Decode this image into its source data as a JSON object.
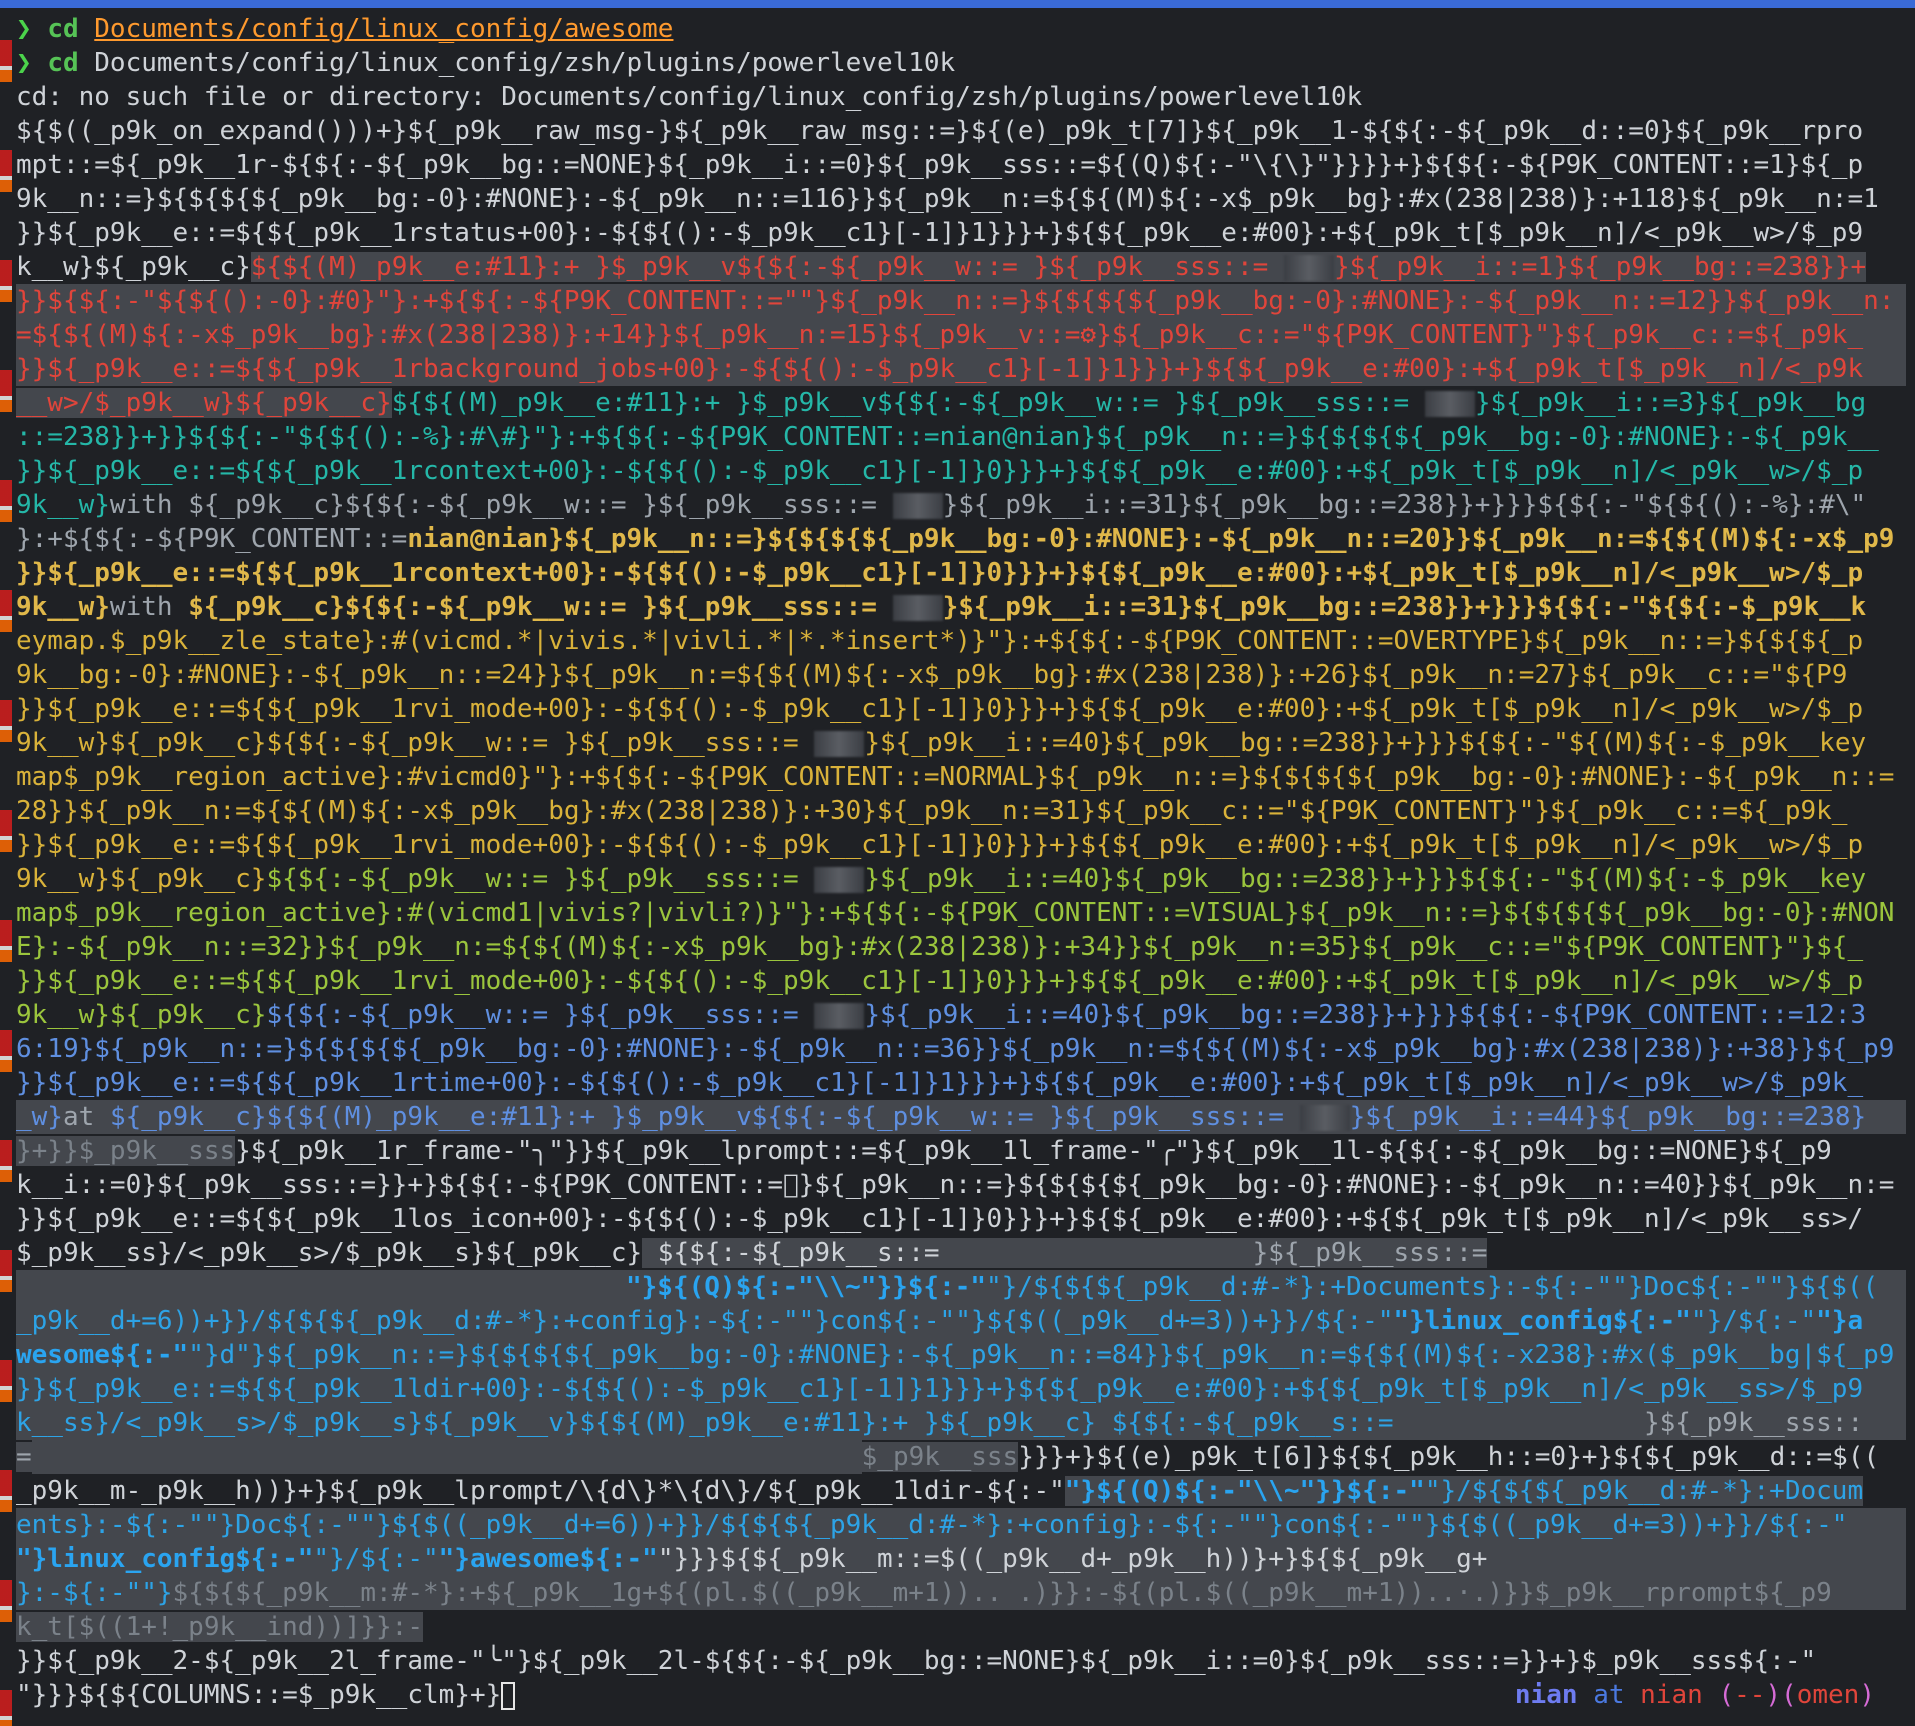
{
  "terminal": {
    "line1": {
      "arrow": "❯",
      "cmd": "cd",
      "path": "Documents/config/linux_config/awesome"
    },
    "line2": {
      "arrow": "❯",
      "cmd": "cd",
      "path": "Documents/config/linux_config/zsh/plugins/powerlevel10k"
    },
    "error": "cd: no such file or directory: Documents/config/linux_config/zsh/plugins/powerlevel10k",
    "garbage": [
      {
        "cls": "c-white",
        "text": "${$((_p9k_on_expand()))+}${_p9k__raw_msg-}${_p9k__raw_msg::=}${(e)_p9k_t[7]}${_p9k__1-${${:-${_p9k__d::=0}${_p9k__rpro"
      },
      {
        "cls": "c-white",
        "text": "mpt::=${_p9k__1r-${${:-${_p9k__bg::=NONE}${_p9k__i::=0}${_p9k__sss::=${(Q)${:-\"\\{\\}\"}}}}+}${${:-${P9K_CONTENT::=1}${_p"
      },
      {
        "cls": "c-white",
        "text": "9k__n::=}${${${${_p9k__bg:-0}:#NONE}:-${_p9k__n::=116}}${_p9k__n:=${${(M)${:-x$_p9k__bg}:#x(238|238)}:+118}${_p9k__n:=1"
      },
      {
        "cls": "c-white",
        "text": "}}${_p9k__e::=${${_p9k__1rstatus+00}:-${${():-$_p9k__c1}[-1]}1}}}+}${${_p9k__e:#00}:+${_p9k_t[$_p9k__n]/<_p9k__w>/$_p9"
      }
    ],
    "seg_line5_a": "k__w}${_p9k__c}",
    "seg_line5_b": "${${(M)_p9k__e:#11}:+ }$_p9k__v${${:-${_p9k__w::= }${_p9k__sss::= ",
    "seg_line5_c": "}${_p9k__i::=1}${_p9k__bg::=238}}+",
    "red_lines": [
      "}}${${:-\"${${():-0}:#0}\"}:+${${:-${P9K_CONTENT::=\"\"}${_p9k__n::=}${${${${_p9k__bg:-0}:#NONE}:-${_p9k__n::=12}}${_p9k__n:",
      "=${${(M)${:-x$_p9k__bg}:#x(238|238)}:+14}}${_p9k__n:=15}${_p9k__v::=⚙}${_p9k__c::=\"${P9K_CONTENT}\"}${_p9k__c::=${_p9k_",
      "}}${_p9k__e::=${${_p9k__1rbackground_jobs+00}:-${${():-$_p9k__c1}[-1]}1}}}+}${${_p9k__e:#00}:+${_p9k_t[$_p9k__n]/<_p9k"
    ],
    "line9_red": "__w>/$_p9k__w}${_p9k__c}",
    "line9_teal_a": "${${(M)_p9k__e:#11}:+ }$_p9k__v${${:-${_p9k__w::= }${_p9k__sss::= ",
    "line9_teal_b": "}${_p9k__i::=3}${_p9k__bg",
    "teal_lines": [
      "::=238}}+}}${${:-\"${${():-%}:#\\#}\"}:+${${:-${P9K_CONTENT::=nian@nian}${_p9k__n::=}${${${${_p9k__bg:-0}:#NONE}:-${_p9k__",
      "}}${_p9k__e::=${${_p9k__1rcontext+00}:-${${():-$_p9k__c1}[-1]}0}}}+}${${_p9k__e:#00}:+${_p9k_t[$_p9k__n]/<_p9k__w>/$_p"
    ],
    "line12_teal": "9k__w}",
    "line12_grey_a": "with ${_p9k__c}${${:-${_p9k__w::= }${_p9k__sss::= ",
    "line12_grey_b": "}${_p9k__i::=31}${_p9k__bg::=238}}+}}}${${:-\"${${():-%}:#\\\"",
    "line13_grey": "}:+${${:-${P9K_CONTENT::=",
    "line13_bold": "nian@nian",
    "line13_grey_b": "}${_p9k__n::=}${${${${_p9k__bg:-0}:#NONE}:-${_p9k__n::=20}}${_p9k__n:=${${(M)${:-x$_p9",
    "yellowb_lines": [
      "}}${_p9k__e::=${${_p9k__1rcontext+00}:-${${():-$_p9k__c1}[-1]}0}}}+}${${_p9k__e:#00}:+${_p9k_t[$_p9k__n]/<_p9k__w>/$_p"
    ],
    "line15_yb": "9k__w}",
    "line15_grey_a": "with ",
    "line15_yb_b": "${_p9k__c}${${:-${_p9k__w::= }${_p9k__sss::= ",
    "line15_yb_c": "}${_p9k__i::=31}${_p9k__bg::=238}}+}}}${${:-\"${${:-$_p9k__k",
    "yellow_lines": [
      "eymap.$_p9k__zle_state}:#(vicmd.*|vivis.*|vivli.*|*.*insert*)}\"}:+${${:-${P9K_CONTENT::=OVERTYPE}${_p9k__n::=}${${${_p",
      "9k__bg:-0}:#NONE}:-${_p9k__n::=24}}${_p9k__n:=${${(M)${:-x$_p9k__bg}:#x(238|238)}:+26}${_p9k__n:=27}${_p9k__c::=\"${P9",
      "}}${_p9k__e::=${${_p9k__1rvi_mode+00}:-${${():-$_p9k__c1}[-1]}0}}}+}${${_p9k__e:#00}:+${_p9k_t[$_p9k__n]/<_p9k__w>/$_p"
    ],
    "line19_yellow_a": "9k__w}${_p9k__c}",
    "line19_yellow_b": "${${:-${_p9k__w::= }${_p9k__sss::= ",
    "line19_yellow_c": "}${_p9k__i::=40}${_p9k__bg::=238}}+}}}${${:-\"${(M)${:-$_p9k__key",
    "yellow2_lines": [
      "map$_p9k__region_active}:#vicmd0}\"}:+${${:-${P9K_CONTENT::=NORMAL}${_p9k__n::=}${${${${_p9k__bg:-0}:#NONE}:-${_p9k__n::=",
      "28}}${_p9k__n:=${${(M)${:-x$_p9k__bg}:#x(238|238)}:+30}${_p9k__n:=31}${_p9k__c::=\"${P9K_CONTENT}\"}${_p9k__c::=${_p9k_",
      "}}${_p9k__e::=${${_p9k__1rvi_mode+00}:-${${():-$_p9k__c1}[-1]}0}}}+}${${_p9k__e:#00}:+${_p9k_t[$_p9k__n]/<_p9k__w>/$_p"
    ],
    "line23_yellow": "9k__w}${_p9k__c}",
    "line23_green_a": "${${:-${_p9k__w::= }${_p9k__sss::= ",
    "line23_green_b": "}${_p9k__i::=40}${_p9k__bg::=238}}+}}}${${:-\"${(M)${:-$_p9k__key",
    "green_lines": [
      "map$_p9k__region_active}:#(vicmd1|vivis?|vivli?)}\"}:+${${:-${P9K_CONTENT::=VISUAL}${_p9k__n::=}${${${${_p9k__bg:-0}:#NON",
      "E}:-${_p9k__n::=32}}${_p9k__n:=${${(M)${:-x$_p9k__bg}:#x(238|238)}:+34}}${_p9k__n:=35}${_p9k__c::=\"${P9K_CONTENT}\"}${_",
      "}}${_p9k__e::=${${_p9k__1rvi_mode+00}:-${${():-$_p9k__c1}[-1]}0}}}+}${${_p9k__e:#00}:+${_p9k_t[$_p9k__n]/<_p9k__w>/$_p"
    ],
    "line27_green": "9k__w}${_p9k__c}",
    "line27_blue_a": "${${:-${_p9k__w::= }${_p9k__sss::= ",
    "line27_blue_b": "}${_p9k__i::=40}${_p9k__bg::=238}}+}}}${${:-${P9K_CONTENT::=12:3",
    "blue_lines": [
      "6:19}${_p9k__n::=}${${${${_p9k__bg:-0}:#NONE}:-${_p9k__n::=36}}${_p9k__n:=${${(M)${:-x$_p9k__bg}:#x(238|238)}:+38}}${_p9",
      "}}${_p9k__e::=${${_p9k__1rtime+00}:-${${():-$_p9k__c1}[-1]}1}}}+}${${_p9k__e:#00}:+${_p9k_t[$_p9k__n]/<_p9k__w>/$_p9k_"
    ],
    "line30_blue": "_w}",
    "line30_grey_a": "at ",
    "line30_blue_b": "${_p9k__c}${${(M)_p9k__e:#11}:+ }$_p9k__v${${:-${_p9k__w::= }${_p9k__sss::= ",
    "line30_blue_c": "}${_p9k__i::=44}${_p9k__bg::=238}",
    "line31_grey": "}+}}$_p9k__sss",
    "line31_white": "}${_p9k__1r_frame-\"╮\"}}${_p9k__lprompt::=${_p9k__1l_frame-\"╭\"}${_p9k__1l-${${:-${_p9k__bg::=NONE}${_p9",
    "line32": "k__i::=0}${_p9k__sss::=}}+}${${:-${P9K_CONTENT::=}${_p9k__n::=}${${${${_p9k__bg:-0}:#NONE}:-${_p9k__n::=40}}${_p9k__n:=",
    "line33": "}}${_p9k__e::=${${_p9k__1los_icon+00}:-${${():-$_p9k__c1}[-1]}0}}}+}${${_p9k__e:#00}:+${${_p9k_t[$_p9k__n]/<_p9k__ss>/",
    "line34_a": "$_p9k__ss}/<_p9k__s>/$_p9k__s}${_p9k__c}",
    "line34_b": " ${${:-${_p9k__s::=                    ",
    "line34_c": "}${_p9k__sss::=",
    "line35_cyan_b": "\"}${(Q)${:-\"\\\\~\"}}${:-\"",
    "line35_cyan": "\"}/${${${_p9k__d:#-*}:+Documents}:-${:-\"\"}Doc${:-\"\"}${$((",
    "line36_cyan": "_p9k__d+=6))+}}/${${${_p9k__d:#-*}:+config}:-${:-\"\"}con${:-\"\"}${$((_p9k__d+=3))+}}/${:-\"",
    "line36_cyan_b": "\"}linux_config${:-\"",
    "line36_cyan_c": "\"}/${:-\"",
    "line36_cyan_d": "\"}a",
    "line37_cyan_b": "wesome${:-\"",
    "line37_cyan": "\"}d\"}${_p9k__n::=}${${${${_p9k__bg:-0}:#NONE}:-${_p9k__n::=84}}${_p9k__n:=${${(M)${:-x238}:#x($_p9k__bg|${_p9",
    "line38_cyan": "}}${_p9k__e::=${${_p9k__1ldir+00}:-${${():-$_p9k__c1}[-1]}1}}}+}${${_p9k__e:#00}:+${${_p9k_t[$_p9k__n]/<_p9k__ss>/$_p9",
    "line39_cyan": "k__ss}/<_p9k__s>/$_p9k__s}${_p9k__v}${${(M)_p9k__e:#11}:+ }${_p9k__c} ${${:-${_p9k__s::=                ",
    "line39_cyan_b": "}${_p9k__sss::",
    "line40_grey": "=",
    "line40_dim": "$_p9k__sss",
    "line40_white": "}}}+}${(e)_p9k_t[6]}${${_p9k__h::=0}+}${${_p9k__d::=$((",
    "line41_white": "_p9k__m-_p9k__h))}+}${_p9k__lprompt/\\{d\\}*\\{d\\}/${_p9k__1ldir-${:-\"",
    "line41_cyan_b": "\"}${(Q)${:-\"\\\\~\"}}${:-\"",
    "line41_cyan": "\"}/${${${_p9k__d:#-*}:+Docum",
    "line42_cyan": "ents}:-${:-\"\"}Doc${:-\"\"}${$((_p9k__d+=6))+}}/${${${_p9k__d:#-*}:+config}:-${:-\"\"}con${:-\"\"}${$((_p9k__d+=3))+}}/${:-\"",
    "line43_cyan_b": "\"}linux_config${:-\"",
    "line43_cyan": "\"}/${:-\"",
    "line43_cyan_c": "\"}awesome${:-\"",
    "line43_white": "\"}}}${${_p9k__m::=$((_p9k__d+_p9k__h))}+}${${_p9k__g+",
    "line44_cyan": "}:-${:-\"\"}",
    "line44_grey": "${${${_p9k__m:#-*}:+${_p9k__1g+${(pl.$((_p9k__m+1)).. .)}}:-${(pl.$((_p9k__m+1))..·.)}}$_p9k__rprompt${_p9",
    "line45_grey": "k_t[$((1+!_p9k__ind))]}}:-",
    "line46_white": "}}${_p9k__2-${_p9k__2l_frame-\"╰\"}${_p9k__2l-${${:-${_p9k__bg::=NONE}${_p9k__i::=0}${_p9k__sss::=}}+}$_p9k__sss${:-\"",
    "line47_white": "\"}}}${${COLUMNS::=$_p9k__clm}+}"
  },
  "rprompt": {
    "user": "nian",
    "at": "at",
    "host": "nian",
    "env_open": "(",
    "env_name": "--",
    "env_mid": ")(",
    "env_name2": "omen",
    "env_close": ")"
  },
  "colors": {
    "accent_top": "#3a6ad6",
    "prompt_green": "#4bd34b",
    "path_orange": "#ff9a2e",
    "segment_red": "#e0453b",
    "segment_teal": "#25b7a8",
    "segment_yellow": "#d9b23a",
    "segment_green": "#9bc53d",
    "segment_blue": "#5f8fe0",
    "segment_cyan": "#2da3e6"
  }
}
